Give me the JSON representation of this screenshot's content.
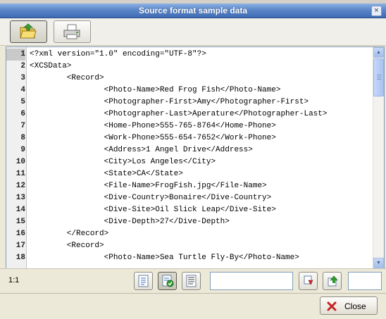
{
  "window": {
    "title": "Source format sample data"
  },
  "toolbar": {
    "buttons": [
      {
        "name": "open-folder",
        "icon": "folder-open-icon"
      },
      {
        "name": "print",
        "icon": "printer-icon"
      }
    ]
  },
  "editor": {
    "current_line": 1,
    "line_numbers": [
      "1",
      "2",
      "3",
      "4",
      "5",
      "6",
      "7",
      "8",
      "9",
      "10",
      "11",
      "12",
      "13",
      "14",
      "15",
      "16",
      "17",
      "18"
    ],
    "lines": [
      "<?xml version=\"1.0\" encoding=\"UTF-8\"?>",
      "<XCSData>",
      "        <Record>",
      "                <Photo-Name>Red Frog Fish</Photo-Name>",
      "                <Photographer-First>Amy</Photographer-First>",
      "                <Photographer-Last>Aperature</Photographer-Last>",
      "                <Home-Phone>555-765-8764</Home-Phone>",
      "                <Work-Phone>555-654-7652</Work-Phone>",
      "                <Address>1 Angel Drive</Address>",
      "                <City>Los Angeles</City>",
      "                <State>CA</State>",
      "                <File-Name>FrogFish.jpg</File-Name>",
      "                <Dive-Country>Bonaire</Dive-Country>",
      "                <Dive-Site>Oil Slick Leap</Dive-Site>",
      "                <Dive-Depth>27</Dive-Depth>",
      "        </Record>",
      "        <Record>",
      "                <Photo-Name>Sea Turtle Fly-By</Photo-Name>"
    ]
  },
  "status": {
    "cursor_position": "1:1",
    "search_value": "",
    "goto_value": ""
  },
  "footer": {
    "close_label": "Close"
  },
  "colors": {
    "title_bar": "#3d6bb3",
    "dialog_bg": "#ece9d8",
    "editor_border": "#7f9db9"
  }
}
